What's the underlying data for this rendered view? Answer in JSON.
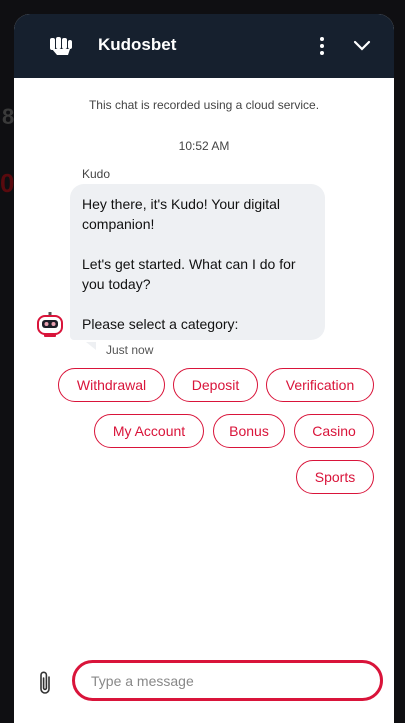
{
  "background": {
    "text_a": "8",
    "text_b": "0"
  },
  "header": {
    "brand": "Kudosbet",
    "menu_icon": "vertical-dots-icon",
    "collapse_icon": "chevron-down-icon",
    "background_color": "#16202e"
  },
  "chat": {
    "notice": "This chat is recorded using a cloud service.",
    "time": "10:52 AM",
    "sender": "Kudo",
    "message": "Hey there, it's Kudo! Your digital companion!\n\nLet's get started. What can I do for you today?\n\nPlease select a category:",
    "timestamp": "Just now"
  },
  "categories": [
    "Withdrawal",
    "Deposit",
    "Verification",
    "My Account",
    "Bonus",
    "Casino",
    "Sports"
  ],
  "composer": {
    "placeholder": "Type a message",
    "attach_icon": "paperclip-icon"
  },
  "colors": {
    "accent": "#d9143a",
    "bubble": "#eef0f3"
  }
}
